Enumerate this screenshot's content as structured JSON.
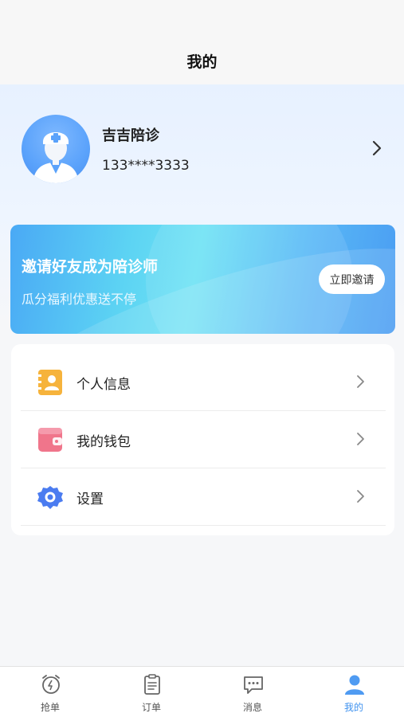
{
  "header": {
    "title": "我的"
  },
  "profile": {
    "name": "吉吉陪诊",
    "phone": "133****3333"
  },
  "banner": {
    "title": "邀请好友成为陪诊师",
    "subtitle": "瓜分福利优惠送不停",
    "button_label": "立即邀请"
  },
  "menu": {
    "items": [
      {
        "label": "个人信息",
        "icon": "id-card-icon",
        "color": "#f6b33c"
      },
      {
        "label": "我的钱包",
        "icon": "wallet-icon",
        "color": "#f0758b"
      },
      {
        "label": "设置",
        "icon": "gear-icon",
        "color": "#4b7cf0"
      }
    ]
  },
  "tabbar": {
    "active": "我的",
    "active_color": "#3f92ef",
    "items": [
      {
        "label": "抢单",
        "icon": "alarm-clock-icon"
      },
      {
        "label": "订单",
        "icon": "clipboard-icon"
      },
      {
        "label": "消息",
        "icon": "chat-bubble-icon"
      },
      {
        "label": "我的",
        "icon": "person-icon"
      }
    ]
  }
}
